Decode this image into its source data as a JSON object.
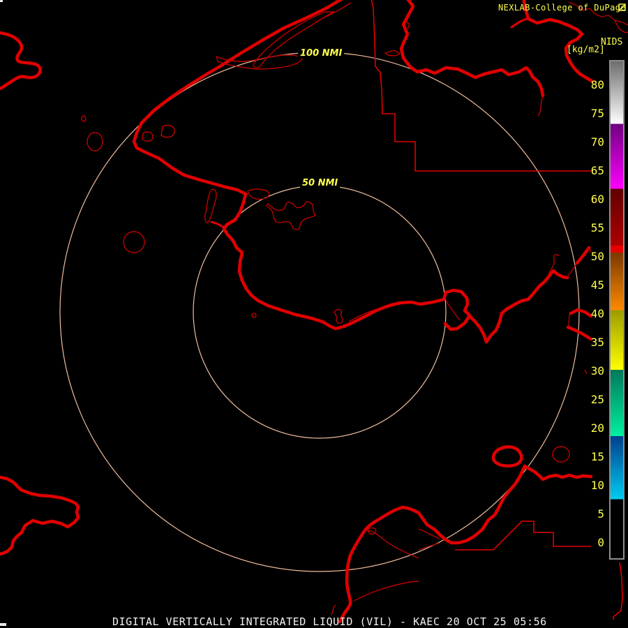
{
  "header": {
    "title": "NEXLAB-College of DuPage",
    "logo_icon": "box-with-diagonal",
    "scale_title": "NIDS",
    "scale_units": "[kg/m2]"
  },
  "rings": [
    {
      "label": "100 NMI"
    },
    {
      "label": "50 NMI"
    }
  ],
  "caption": "DIGITAL VERTICALLY INTEGRATED LIQUID (VIL) - KAEC 20 OCT 25 05:56",
  "colorbar": {
    "ticks": [
      {
        "v": "80",
        "p": 5.06
      },
      {
        "v": "75",
        "p": 10.81
      },
      {
        "v": "70",
        "p": 16.57
      },
      {
        "v": "65",
        "p": 22.33
      },
      {
        "v": "60",
        "p": 28.09
      },
      {
        "v": "55",
        "p": 33.85
      },
      {
        "v": "50",
        "p": 39.61
      },
      {
        "v": "45",
        "p": 45.36
      },
      {
        "v": "40",
        "p": 51.12
      },
      {
        "v": "35",
        "p": 56.88
      },
      {
        "v": "30",
        "p": 62.64
      },
      {
        "v": "25",
        "p": 68.4
      },
      {
        "v": "20",
        "p": 74.16
      },
      {
        "v": "15",
        "p": 79.92
      },
      {
        "v": "10",
        "p": 85.67
      },
      {
        "v": "5",
        "p": 91.43
      },
      {
        "v": "0",
        "p": 97.19
      }
    ],
    "segments": [
      {
        "from_pct": 0,
        "to_pct": 12.6,
        "from_color": "#6E6E6E",
        "to_color": "#FFFFFF"
      },
      {
        "from_pct": 12.6,
        "to_pct": 25.6,
        "from_color": "#6F0080",
        "to_color": "#FF00FF"
      },
      {
        "from_pct": 25.6,
        "to_pct": 37.1,
        "from_color": "#600000",
        "to_color": "#AE0000"
      },
      {
        "from_pct": 37.1,
        "to_pct": 38.5,
        "from_color": "#E80000",
        "to_color": "#E80000"
      },
      {
        "from_pct": 38.5,
        "to_pct": 50.1,
        "from_color": "#7A3900",
        "to_color": "#FF8A00"
      },
      {
        "from_pct": 50.1,
        "to_pct": 62.1,
        "from_color": "#9C9C00",
        "to_color": "#FFFF00"
      },
      {
        "from_pct": 62.1,
        "to_pct": 75.4,
        "from_color": "#00785A",
        "to_color": "#00F0A0"
      },
      {
        "from_pct": 75.4,
        "to_pct": 88.1,
        "from_color": "#003F8C",
        "to_color": "#00CCF2"
      },
      {
        "from_pct": 88.1,
        "to_pct": 100,
        "from_color": "#000000",
        "to_color": "#000000"
      }
    ]
  },
  "colors": {
    "map_line": "#E10000",
    "map_thin": "#BE0000",
    "ring": "#F0BE9E",
    "label_yellow": "#FFFF4D",
    "caption_white": "#F2F2F2"
  }
}
